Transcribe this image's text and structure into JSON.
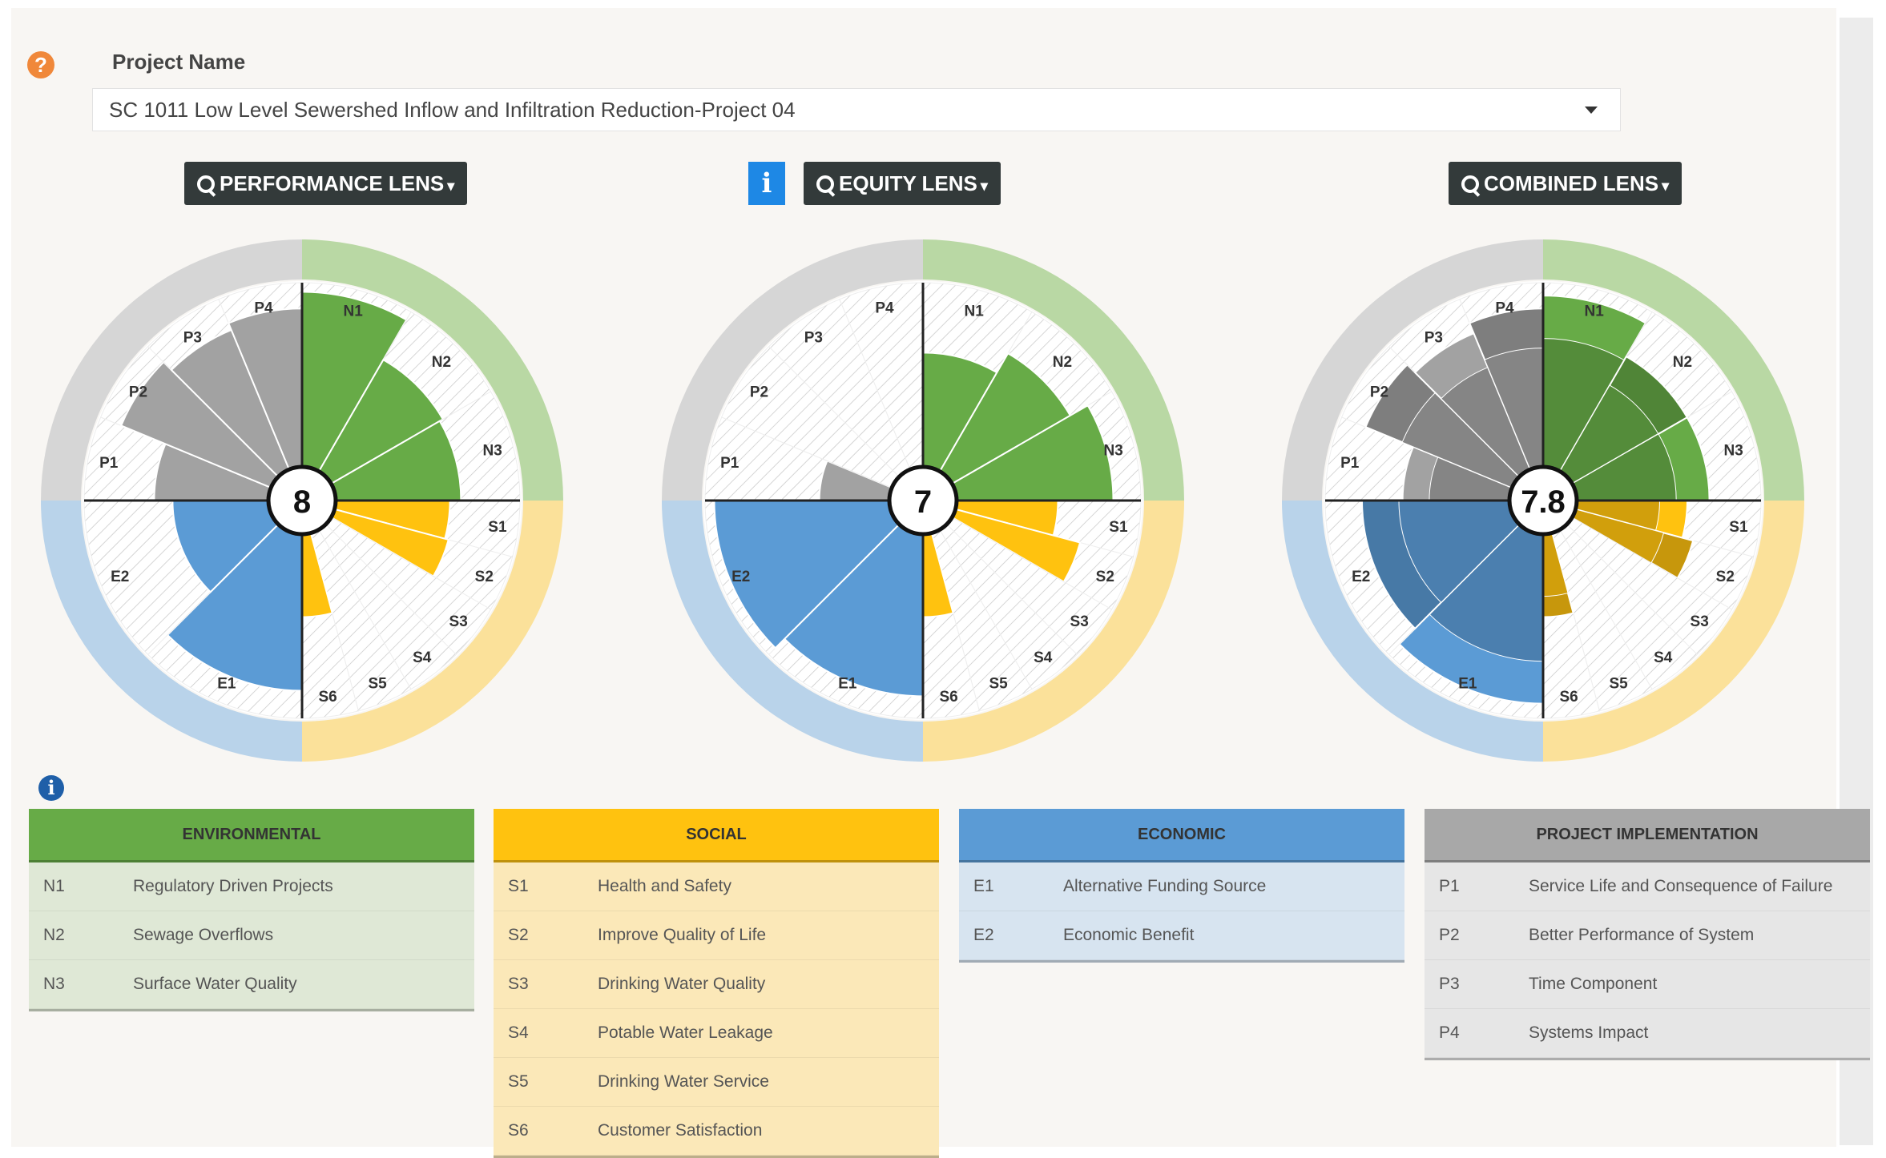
{
  "project": {
    "label": "Project Name",
    "selected": "SC 1011 Low Level Sewershed Inflow and Infiltration Reduction-Project 04"
  },
  "icons": {
    "help": "question-icon",
    "info": "info-icon",
    "search": "search-icon",
    "dropdown": "caret-down-icon"
  },
  "lenses": {
    "performance": "PERFORMANCE LENS",
    "equity": "EQUITY LENS",
    "combined": "COMBINED LENS"
  },
  "info_glyph": "i",
  "help_glyph": "?",
  "colors": {
    "environmental": "#67ab47",
    "social": "#ffc20f",
    "economic": "#5b9bd5",
    "implementation": "#a2a2a2"
  },
  "scores": {
    "performance": "8",
    "equity": "7",
    "combined": "7.8"
  },
  "chart_labels": {
    "env": [
      "N1",
      "N2",
      "N3"
    ],
    "soc": [
      "S1",
      "S2",
      "S3",
      "S4",
      "S5",
      "S6"
    ],
    "eco": [
      "E1",
      "E2"
    ],
    "imp": [
      "P1",
      "P2",
      "P3",
      "P4"
    ]
  },
  "chart_data": [
    {
      "type": "polar-area",
      "name": "performance",
      "score": 8,
      "rmax": 1,
      "segments": {
        "N1": 0.95,
        "N2": 0.7,
        "N3": 0.68,
        "S1": 0.62,
        "S2": 0.64,
        "S3": 0,
        "S4": 0,
        "S5": 0,
        "S6": 0.45,
        "E1": 0.85,
        "E2": 0.52,
        "P1": 0.62,
        "P2": 0.88,
        "P3": 0.82,
        "P4": 0.86
      }
    },
    {
      "type": "polar-area",
      "name": "equity",
      "score": 7,
      "rmax": 1,
      "segments": {
        "N1": 0.62,
        "N2": 0.74,
        "N3": 0.85,
        "S1": 0.55,
        "S2": 0.7,
        "S3": 0,
        "S4": 0,
        "S5": 0,
        "S6": 0.45,
        "E1": 0.88,
        "E2": 0.95,
        "P1": 0.38,
        "P2": 0,
        "P3": 0,
        "P4": 0
      }
    },
    {
      "type": "polar-area",
      "name": "combined",
      "score": 7.8,
      "rmax": 1,
      "segments": {
        "N1": 0.93,
        "N2": 0.72,
        "N3": 0.72,
        "S1": 0.6,
        "S2": 0.66,
        "S3": 0,
        "S4": 0,
        "S5": 0,
        "S6": 0.45,
        "E1": 0.92,
        "E2": 0.8,
        "P1": 0.58,
        "P2": 0.86,
        "P3": 0.8,
        "P4": 0.86
      }
    }
  ],
  "legend": {
    "environmental": {
      "title": "ENVIRONMENTAL",
      "rows": [
        {
          "code": "N1",
          "label": "Regulatory Driven Projects"
        },
        {
          "code": "N2",
          "label": "Sewage Overflows"
        },
        {
          "code": "N3",
          "label": "Surface Water Quality"
        }
      ]
    },
    "social": {
      "title": "SOCIAL",
      "rows": [
        {
          "code": "S1",
          "label": "Health and Safety"
        },
        {
          "code": "S2",
          "label": "Improve Quality of Life"
        },
        {
          "code": "S3",
          "label": "Drinking Water Quality"
        },
        {
          "code": "S4",
          "label": "Potable Water Leakage"
        },
        {
          "code": "S5",
          "label": "Drinking Water Service"
        },
        {
          "code": "S6",
          "label": "Customer Satisfaction"
        }
      ]
    },
    "economic": {
      "title": "ECONOMIC",
      "rows": [
        {
          "code": "E1",
          "label": "Alternative Funding Source"
        },
        {
          "code": "E2",
          "label": "Economic Benefit"
        }
      ]
    },
    "implementation": {
      "title": "PROJECT IMPLEMENTATION",
      "rows": [
        {
          "code": "P1",
          "label": "Service Life and Consequence of Failure"
        },
        {
          "code": "P2",
          "label": "Better Performance of System"
        },
        {
          "code": "P3",
          "label": "Time Component"
        },
        {
          "code": "P4",
          "label": "Systems Impact"
        }
      ]
    }
  }
}
